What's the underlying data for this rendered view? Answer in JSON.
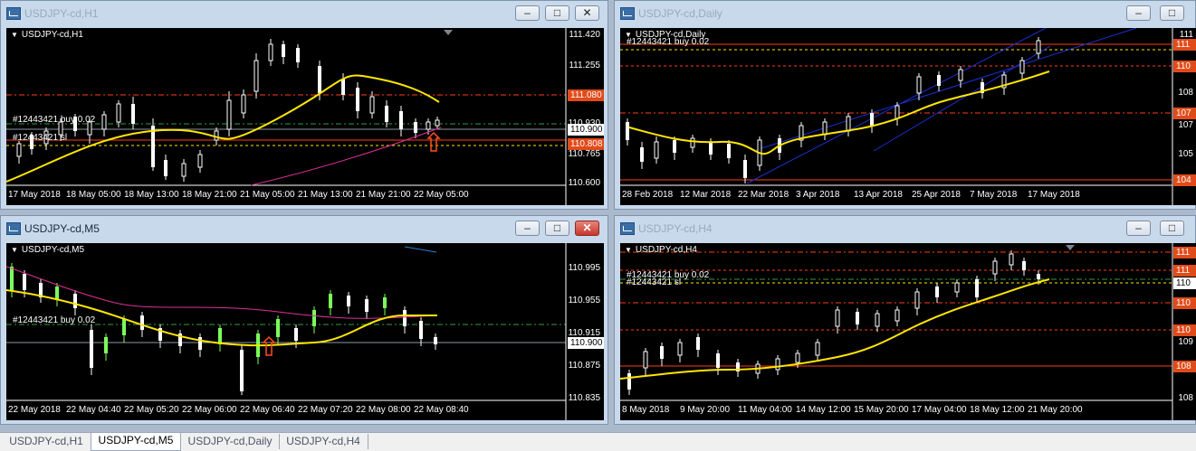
{
  "windows": [
    {
      "title": "USDJPY-cd,H1",
      "symbol": "USDJPY-cd,H1",
      "price_scale": [
        "111.420",
        "111.255",
        "111.080",
        "110.930",
        "110.900",
        "110.808",
        "110.765",
        "110.600"
      ],
      "orders": [
        "#12443421 buy 0.02",
        "#12443421 sl"
      ],
      "dates": [
        "17 May 2018",
        "18 May 05:00",
        "18 May 13:00",
        "18 May 21:00",
        "21 May 05:00",
        "21 May 13:00",
        "21 May 21:00",
        "22 May 05:00"
      ],
      "current_price": "110.900",
      "highlighted_levels": [
        "111.080",
        "110.808"
      ]
    },
    {
      "title": "USDJPY-cd,Daily",
      "symbol": "USDJPY-cd,Daily",
      "price_scale": [
        "111",
        "111",
        "110",
        "108",
        "107",
        "107",
        "105",
        "104"
      ],
      "orders": [
        "#12443421 buy 0.02"
      ],
      "dates": [
        "28 Feb 2018",
        "12 Mar 2018",
        "22 Mar 2018",
        "3 Apr 2018",
        "13 Apr 2018",
        "25 Apr 2018",
        "7 May 2018",
        "17 May 2018"
      ]
    },
    {
      "title": "USDJPY-cd,M5",
      "symbol": "USDJPY-cd,M5",
      "price_scale": [
        "110.995",
        "110.955",
        "110.915",
        "110.900",
        "110.875",
        "110.835"
      ],
      "orders": [
        "#12443421 buy 0.02"
      ],
      "dates": [
        "22 May 2018",
        "22 May 04:40",
        "22 May 05:20",
        "22 May 06:00",
        "22 May 06:40",
        "22 May 07:20",
        "22 May 08:00",
        "22 May 08:40"
      ],
      "current_price": "110.900"
    },
    {
      "title": "USDJPY-cd,H4",
      "symbol": "USDJPY-cd,H4",
      "price_scale": [
        "111",
        "111",
        "110",
        "110",
        "110",
        "109",
        "108",
        "108"
      ],
      "orders": [
        "#12443421 buy 0.02",
        "#12443421 sl"
      ],
      "dates": [
        "8 May 2018",
        "9 May 20:00",
        "11 May 04:00",
        "14 May 12:00",
        "15 May 20:00",
        "17 May 04:00",
        "18 May 12:00",
        "21 May 20:00"
      ]
    }
  ],
  "tabs": [
    "USDJPY-cd,H1",
    "USDJPY-cd,M5",
    "USDJPY-cd,Daily",
    "USDJPY-cd,H4"
  ],
  "active_tab": "USDJPY-cd,M5",
  "controls": {
    "minimize": "–",
    "maximize": "□",
    "close": "✕"
  },
  "colors": {
    "bull": "#7cff5a",
    "bear": "#ffffff",
    "ma_fast": "#ffe600",
    "ma_slow": "#e0309a",
    "channel": "#1a2fd0",
    "level_red": "#ff3c14",
    "level_green": "#4caf50"
  }
}
